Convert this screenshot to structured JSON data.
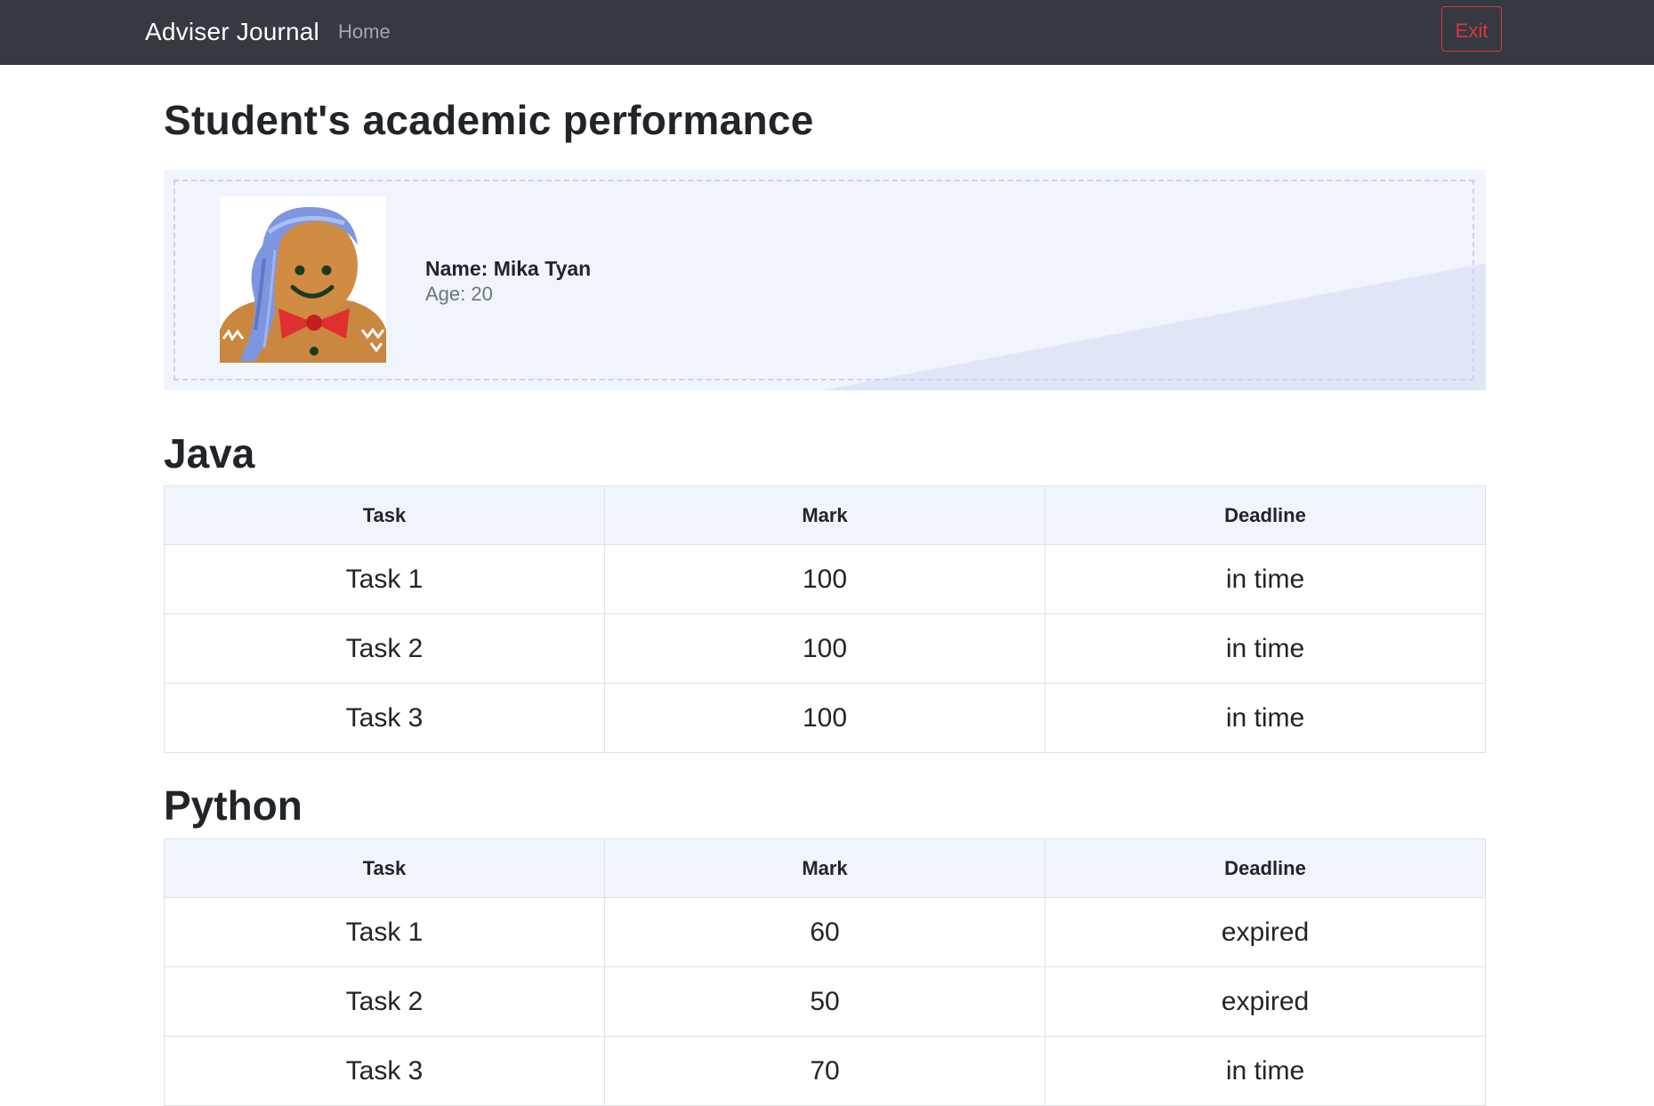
{
  "navbar": {
    "brand": "Adviser Journal",
    "home_label": "Home",
    "exit_label": "Exit",
    "exit_color": "#dc3545",
    "background": "#343a40"
  },
  "page": {
    "title": "Student's academic performance"
  },
  "student": {
    "name_label": "Name:",
    "name": "Mika Tyan",
    "age_label": "Age:",
    "age": "20",
    "avatar_icon": "gingerbread-avatar-icon"
  },
  "subjects": [
    {
      "title": "Java",
      "headers": [
        "Task",
        "Mark",
        "Deadline"
      ],
      "rows": [
        [
          "Task 1",
          "100",
          "in time"
        ],
        [
          "Task 2",
          "100",
          "in time"
        ],
        [
          "Task 3",
          "100",
          "in time"
        ]
      ]
    },
    {
      "title": "Python",
      "headers": [
        "Task",
        "Mark",
        "Deadline"
      ],
      "rows": [
        [
          "Task 1",
          "60",
          "expired"
        ],
        [
          "Task 2",
          "50",
          "expired"
        ],
        [
          "Task 3",
          "70",
          "in time"
        ]
      ]
    }
  ]
}
